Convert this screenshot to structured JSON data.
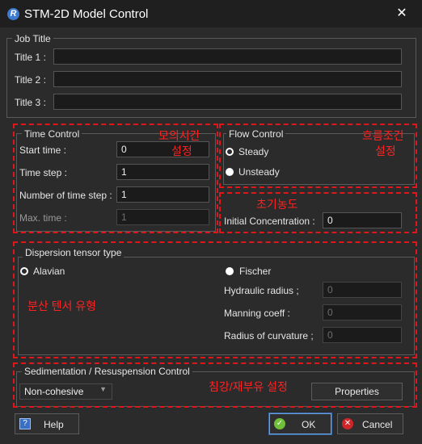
{
  "window": {
    "title": "STM-2D Model Control",
    "icon": "R"
  },
  "job": {
    "group_title": "Job Title",
    "title1_label": "Title 1 :",
    "title1_value": "",
    "title2_label": "Title 2 :",
    "title2_value": "",
    "title3_label": "Title 3 :",
    "title3_value": ""
  },
  "time_control": {
    "group_title": "Time Control",
    "start_label": "Start time :",
    "start_value": "0",
    "step_label": "Time step :",
    "step_value": "1",
    "nsteps_label": "Number of time step :",
    "nsteps_value": "1",
    "max_label": "Max. time :",
    "max_value": "1",
    "annotation_line1": "모의시간",
    "annotation_line2": "설정"
  },
  "flow_control": {
    "group_title": "Flow Control",
    "steady_label": "Steady",
    "steady_selected": true,
    "unsteady_label": "Unsteady",
    "annotation_line1": "흐름조건",
    "annotation_line2": "설정"
  },
  "initial": {
    "annotation": "초기농도",
    "label": "Initial Concentration :",
    "value": "0"
  },
  "dispersion": {
    "group_title": "Dispersion tensor type",
    "alavian_label": "Alavian",
    "alavian_selected": true,
    "fischer_label": "Fischer",
    "hydraulic_label": "Hydraulic radius ;",
    "hydraulic_value": "0",
    "manning_label": "Manning coeff :",
    "manning_value": "0",
    "curvature_label": "Radius of curvature ;",
    "curvature_value": "0",
    "annotation": "분산 텐서 유형"
  },
  "sedimentation": {
    "group_title": "Sedimentation / Resuspension Control",
    "mode_value": "Non-cohesive",
    "properties_label": "Properties",
    "annotation": "침강/재부유 설정"
  },
  "footer": {
    "help_label": "Help",
    "ok_label": "OK",
    "cancel_label": "Cancel"
  },
  "colors": {
    "annotation": "#ff2222",
    "background": "#2b2b2b",
    "titlebar": "#1f1f1f",
    "ok_icon": "#6fbf3a",
    "cancel_icon": "#d0262a"
  }
}
